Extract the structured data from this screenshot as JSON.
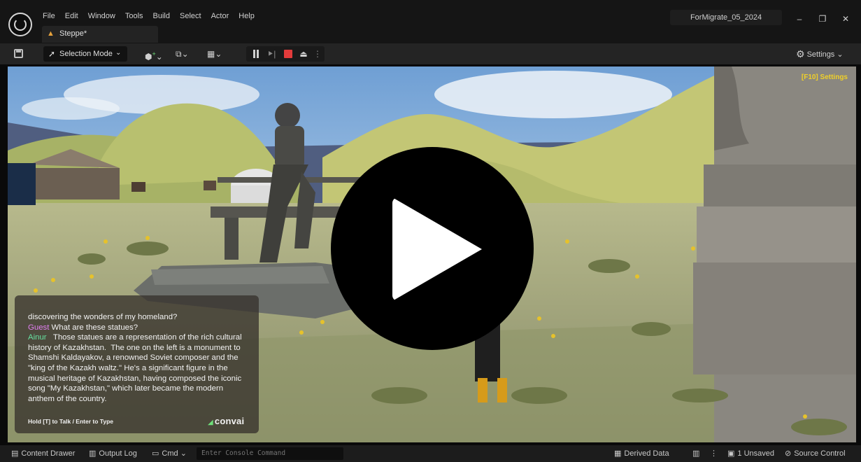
{
  "window": {
    "menu": [
      "File",
      "Edit",
      "Window",
      "Tools",
      "Build",
      "Select",
      "Actor",
      "Help"
    ],
    "tab_label": "Steppe*",
    "project_name": "ForMigrate_05_2024"
  },
  "toolbar": {
    "selection_mode": "Selection Mode",
    "settings_label": "Settings"
  },
  "viewport": {
    "f10_label": "[F10] Settings",
    "chat": {
      "line_top": "discovering the wonders of my homeland?",
      "guest_speaker": "Guest",
      "guest_text": " What are these statues?",
      "ainur_speaker": "Ainur",
      "ainur_text": "   Those statues are a representation of the rich cultural history of Kazakhstan.  The one on the left is a monument to Shamshi Kaldayakov, a renowned Soviet composer and the \"king of the Kazakh waltz.\" He's a significant figure in the musical heritage of Kazakhstan, having composed the iconic song \"My Kazakhstan,\" which later became the modern anthem of the country.",
      "hint": "Hold [T] to Talk / Enter to Type",
      "brand": "convai"
    }
  },
  "statusbar": {
    "content_drawer": "Content Drawer",
    "output_log": "Output Log",
    "cmd": "Cmd",
    "console_placeholder": "Enter Console Command",
    "derived_data": "Derived Data",
    "unsaved": "1 Unsaved",
    "source_control": "Source Control"
  },
  "colors": {
    "accent_yellow": "#f0d028",
    "guest_name": "#e07ff0",
    "ainur_name": "#66e0a0",
    "stop_red": "#e23b3b"
  }
}
